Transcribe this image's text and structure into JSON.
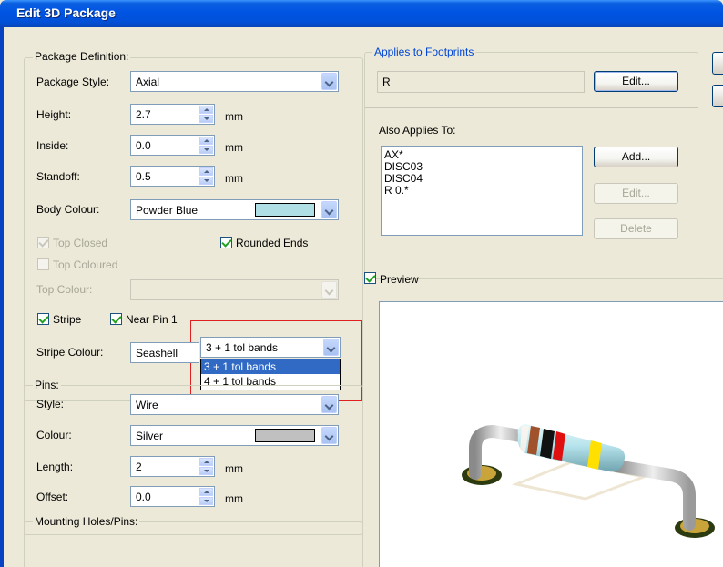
{
  "window": {
    "title": "Edit 3D Package"
  },
  "package_definition": {
    "group_label": "Package Definition:",
    "package_style": {
      "label": "Package Style:",
      "value": "Axial"
    },
    "height": {
      "label": "Height:",
      "value": "2.7",
      "unit": "mm"
    },
    "inside": {
      "label": "Inside:",
      "value": "0.0",
      "unit": "mm"
    },
    "standoff": {
      "label": "Standoff:",
      "value": "0.5",
      "unit": "mm"
    },
    "body_colour": {
      "label": "Body Colour:",
      "value": "Powder Blue",
      "swatch": "#b0e0e6"
    },
    "top_closed": {
      "label": "Top Closed",
      "checked": true,
      "enabled": false
    },
    "rounded_ends": {
      "label": "Rounded Ends",
      "checked": true
    },
    "top_coloured": {
      "label": "Top Coloured",
      "checked": false,
      "enabled": false
    },
    "top_colour": {
      "label": "Top Colour:"
    },
    "stripe": {
      "label": "Stripe",
      "checked": true
    },
    "near_pin_1": {
      "label": "Near Pin 1",
      "checked": true
    },
    "bands": {
      "value": "3 + 1 tol bands",
      "options": [
        "3 + 1 tol bands",
        "4 + 1 tol bands"
      ],
      "selected_index": 0
    },
    "stripe_colour": {
      "label": "Stripe Colour:",
      "value": "Seashell"
    }
  },
  "pins": {
    "group_label": "Pins:",
    "style": {
      "label": "Style:",
      "value": "Wire"
    },
    "colour": {
      "label": "Colour:",
      "value": "Silver",
      "swatch": "#c0c0c0"
    },
    "length": {
      "label": "Length:",
      "value": "2",
      "unit": "mm"
    },
    "offset": {
      "label": "Offset:",
      "value": "0.0",
      "unit": "mm"
    }
  },
  "mounting": {
    "group_label": "Mounting Holes/Pins:"
  },
  "applies_to_footprints": {
    "group_label": "Applies to Footprints",
    "value": "R",
    "edit_button": "Edit..."
  },
  "also_applies": {
    "label": "Also Applies To:",
    "items": [
      "AX*",
      "DISC03",
      "DISC04",
      "R 0.*"
    ],
    "add_button": "Add...",
    "edit_button": "Edit...",
    "delete_button": "Delete"
  },
  "preview": {
    "label": "Preview",
    "checked": true
  },
  "colors": {
    "title_bar": "#0054e3",
    "highlight": "#e02020",
    "selection": "#316ac5"
  }
}
